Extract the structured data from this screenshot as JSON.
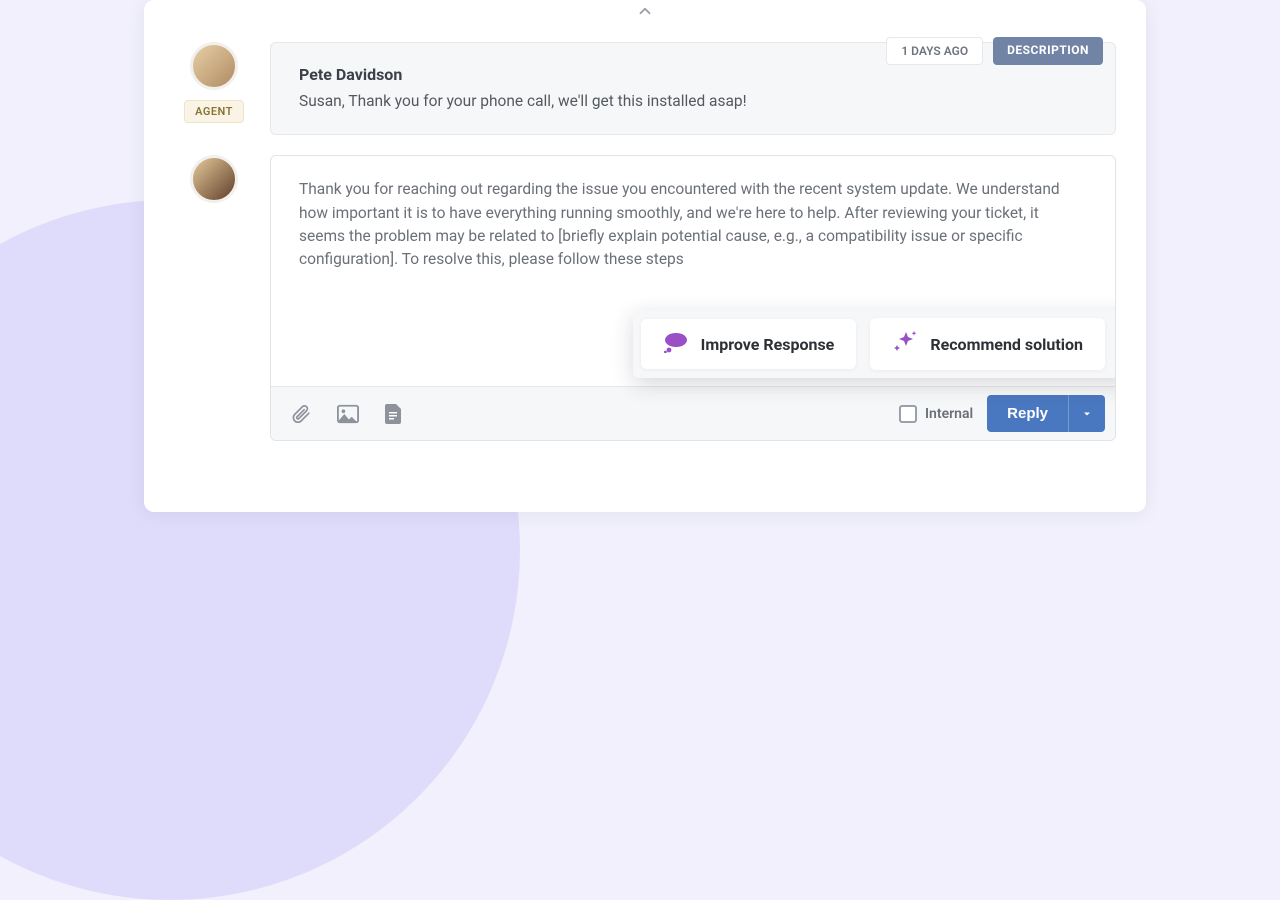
{
  "badges": {
    "time": "1 DAYS AGO",
    "desc": "DESCRIPTION",
    "agent": "AGENT"
  },
  "message": {
    "author": "Pete Davidson",
    "body": "Susan, Thank you for your phone call, we'll get this installed asap!"
  },
  "editor": {
    "draft": "Thank you for reaching out regarding the issue you encountered with the recent system update. We understand how important it is to have everything running smoothly, and we're here to help. After reviewing your ticket, it seems the problem may be related to [briefly explain potential cause, e.g., a compatibility issue or specific configuration]. To resolve this, please follow these steps"
  },
  "toolbar": {
    "internal_label": "Internal",
    "reply_label": "Reply"
  },
  "ai": {
    "improve_label": "Improve Response",
    "recommend_label": "Recommend solution"
  },
  "colors": {
    "accent_blue": "#4a78c0",
    "accent_purple": "#9a4fc7",
    "badge_blue": "#7184a6"
  }
}
